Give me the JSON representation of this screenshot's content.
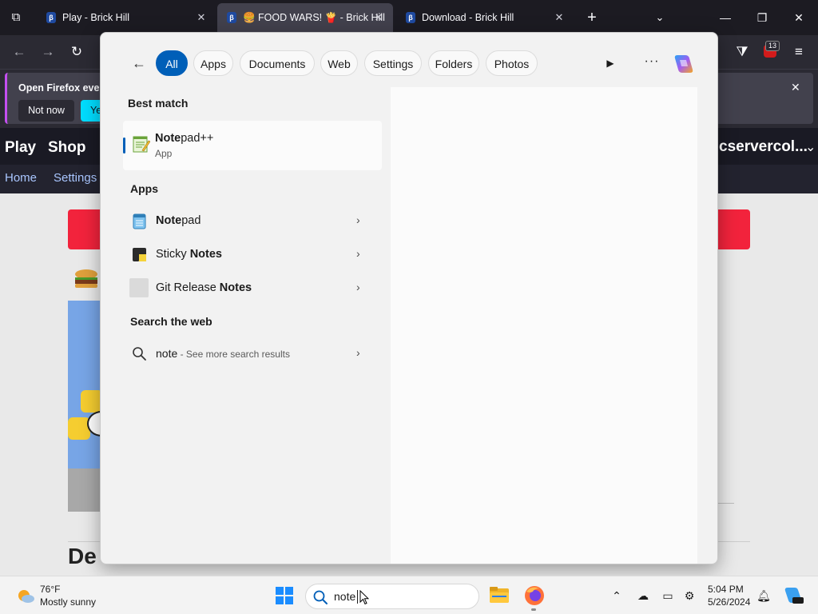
{
  "browser": {
    "tabs": [
      {
        "label": "Play - Brick Hill",
        "active": false
      },
      {
        "label": "🍔 FOOD WARS! 🍟 - Brick Hill",
        "active": true
      },
      {
        "label": "Download - Brick Hill",
        "active": false
      }
    ],
    "extension_badge": "13",
    "notification": {
      "title": "Open Firefox ever",
      "not_now": "Not now",
      "yes": "Yes"
    }
  },
  "website": {
    "nav": [
      "Play",
      "Shop"
    ],
    "username": "cservercol...",
    "subnav": [
      "Home",
      "Settings"
    ],
    "heading_partial": "De"
  },
  "search": {
    "filters": [
      "All",
      "Apps",
      "Documents",
      "Web",
      "Settings",
      "Folders",
      "Photos"
    ],
    "active_filter": "All",
    "best_match_label": "Best match",
    "best_match": {
      "bold": "Note",
      "rest": "pad++",
      "type": "App"
    },
    "apps_label": "Apps",
    "apps": [
      {
        "pre": "",
        "bold": "Note",
        "post": "pad",
        "icon": "notepad-icon"
      },
      {
        "pre": "Sticky ",
        "bold": "Notes",
        "post": "",
        "icon": "sticky-notes-icon"
      },
      {
        "pre": "Git Release ",
        "bold": "Notes",
        "post": "",
        "icon": "git-release-notes-icon"
      }
    ],
    "web_label": "Search the web",
    "web_result": {
      "query": "note",
      "suffix": " - See more search results"
    }
  },
  "taskbar": {
    "weather_temp": "76°F",
    "weather_desc": "Mostly sunny",
    "search_text": "note",
    "time": "5:04 PM",
    "date": "5/26/2024"
  },
  "colors": {
    "accent": "#005fb8",
    "browser_dark": "#1c1b22",
    "site_red": "#f2233c"
  }
}
